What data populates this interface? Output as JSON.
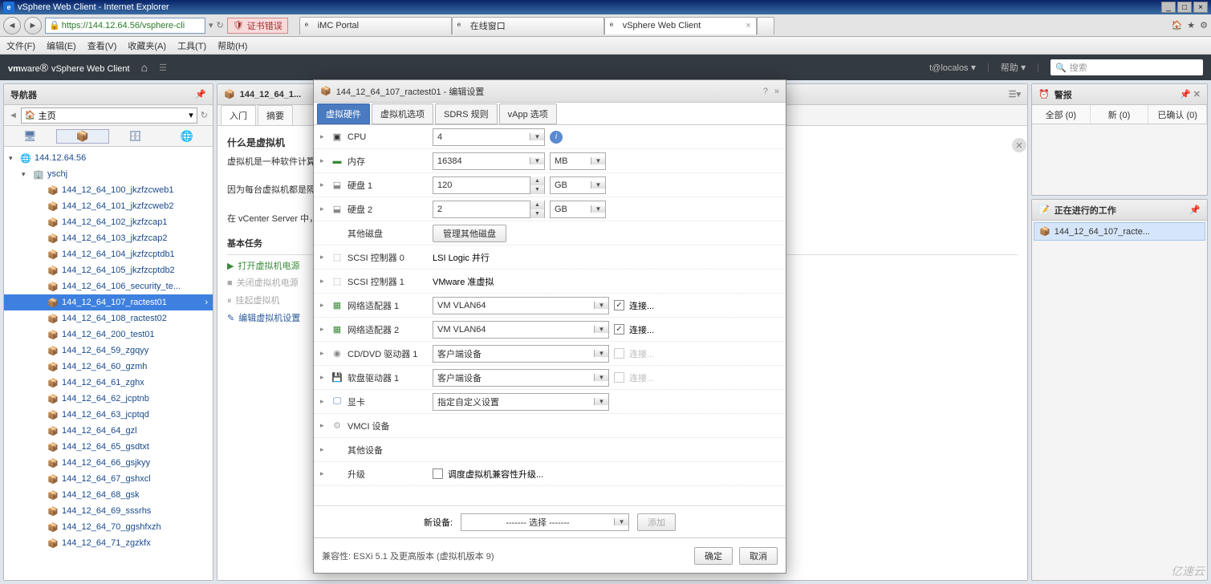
{
  "ie": {
    "title": "vSphere Web Client - Internet Explorer",
    "url": "https://144.12.64.56/vsphere-cli",
    "cert_err": "证书错误",
    "tabs": [
      "iMC Portal",
      "在线窗口",
      "vSphere Web Client"
    ],
    "menus": [
      "文件(F)",
      "编辑(E)",
      "查看(V)",
      "收藏夹(A)",
      "工具(T)",
      "帮助(H)"
    ]
  },
  "topbar": {
    "brand_a": "vm",
    "brand_b": "ware",
    "product": "vSphere Web Client",
    "user": "t@localos",
    "help": "帮助",
    "search_ph": "搜索"
  },
  "nav": {
    "title": "导航器",
    "breadcrumb": "主页",
    "root": "144.12.64.56",
    "dc": "yschj",
    "vms": [
      "144_12_64_100_jkzfzcweb1",
      "144_12_64_101_jkzfzcweb2",
      "144_12_64_102_jkzfzcap1",
      "144_12_64_103_jkzfzcap2",
      "144_12_64_104_jkzfzcptdb1",
      "144_12_64_105_jkzfzcptdb2",
      "144_12_64_106_security_te...",
      "144_12_64_107_ractest01",
      "144_12_64_108_ractest02",
      "144_12_64_200_test01",
      "144_12_64_59_zgqyy",
      "144_12_64_60_gzmh",
      "144_12_64_61_zghx",
      "144_12_64_62_jcptnb",
      "144_12_64_63_jcptqd",
      "144_12_64_64_gzl",
      "144_12_64_65_gsdtxt",
      "144_12_64_66_gsjkyy",
      "144_12_64_67_gshxcl",
      "144_12_64_68_gsk",
      "144_12_64_69_sssrhs",
      "144_12_64_70_ggshfxzh",
      "144_12_64_71_zgzkfx"
    ],
    "selected_index": 7
  },
  "center": {
    "header": "144_12_64_1...",
    "tabs": [
      "入门",
      "摘要"
    ],
    "q": "什么是虚拟机",
    "p1": "虚拟机是一种软件计算机，与物理机一样运行操作系统和应用程序。虚拟机由一组规范和配置文件组成...",
    "p2": "因为每台虚拟机都是隔离的，所以可以将虚拟机用作桌面或工作站环境，或用来整合服务器应用程序。",
    "p3": "在 vCenter Server 中，虚拟机在主机或群集上运行。同一台主机可以运行许多虚拟机。",
    "tasks_hd": "基本任务",
    "tasks": [
      "打开虚拟机电源",
      "关闭虚拟机电源",
      "挂起虚拟机",
      "编辑虚拟机设置"
    ]
  },
  "alarms": {
    "title": "警报",
    "tabs": [
      "全部 (0)",
      "新 (0)",
      "已确认 (0)"
    ]
  },
  "work": {
    "title": "正在进行的工作",
    "item": "144_12_64_107_racte..."
  },
  "modal": {
    "title": "144_12_64_107_ractest01 - 编辑设置",
    "tabs": [
      "虚拟硬件",
      "虚拟机选项",
      "SDRS 规则",
      "vApp 选项"
    ],
    "cpu": {
      "label": "CPU",
      "value": "4"
    },
    "mem": {
      "label": "内存",
      "value": "16384",
      "unit": "MB"
    },
    "disk1": {
      "label": "硬盘 1",
      "value": "120",
      "unit": "GB"
    },
    "disk2": {
      "label": "硬盘 2",
      "value": "2",
      "unit": "GB"
    },
    "other_disk": {
      "label": "其他磁盘",
      "btn": "管理其他磁盘"
    },
    "scsi0": {
      "label": "SCSI 控制器 0",
      "value": "LSI Logic 并行"
    },
    "scsi1": {
      "label": "SCSI 控制器 1",
      "value": "VMware 准虚拟"
    },
    "net1": {
      "label": "网络适配器 1",
      "value": "VM VLAN64",
      "chk": "连接..."
    },
    "net2": {
      "label": "网络适配器 2",
      "value": "VM VLAN64",
      "chk": "连接..."
    },
    "cd": {
      "label": "CD/DVD 驱动器 1",
      "value": "客户端设备",
      "chk": "连接..."
    },
    "floppy": {
      "label": "软盘驱动器 1",
      "value": "客户端设备",
      "chk": "连接..."
    },
    "video": {
      "label": "显卡",
      "value": "指定自定义设置"
    },
    "vmci": {
      "label": "VMCI 设备"
    },
    "other_dev": {
      "label": "其他设备"
    },
    "upgrade": {
      "label": "升级",
      "chk": "调度虚拟机兼容性升级..."
    },
    "newdev": {
      "label": "新设备:",
      "value": "------- 选择 -------",
      "add": "添加"
    },
    "compat": "兼容性: ESXi 5.1 及更高版本 (虚拟机版本 9)",
    "ok": "确定",
    "cancel": "取消"
  },
  "watermark": "亿速云"
}
